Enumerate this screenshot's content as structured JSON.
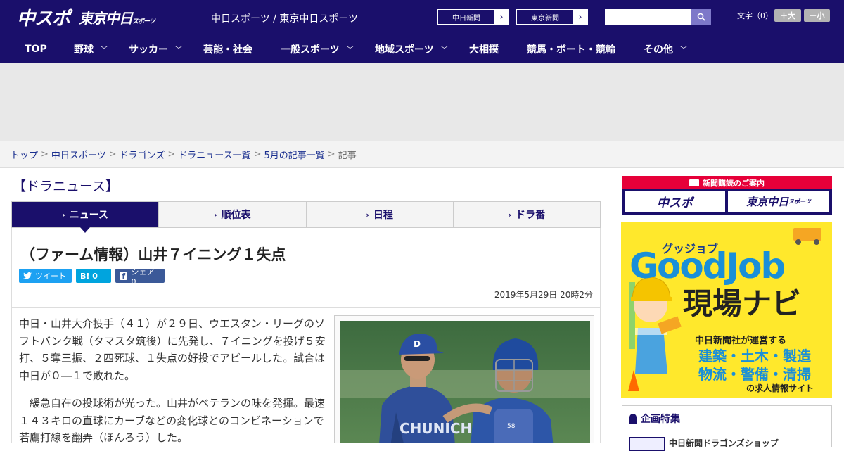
{
  "header": {
    "logo_main": "中スポ",
    "logo_tokyo": "東京中日",
    "logo_tokyo_small": "スポーツ",
    "site_names": "中日スポーツ / 東京中日スポーツ",
    "link_chunichi": "中日新聞",
    "link_tokyo": "東京新聞",
    "font_label": "文字（0）",
    "font_up": "＋大",
    "font_down": "－小"
  },
  "nav": {
    "items": [
      {
        "label": "TOP",
        "has_menu": false
      },
      {
        "label": "野球",
        "has_menu": true
      },
      {
        "label": "サッカー",
        "has_menu": true
      },
      {
        "label": "芸能・社会",
        "has_menu": false
      },
      {
        "label": "一般スポーツ",
        "has_menu": true
      },
      {
        "label": "地域スポーツ",
        "has_menu": true
      },
      {
        "label": "大相撲",
        "has_menu": false
      },
      {
        "label": "競馬・ボート・競輪",
        "has_menu": false
      },
      {
        "label": "その他",
        "has_menu": true
      }
    ]
  },
  "breadcrumb": {
    "items": [
      "トップ",
      "中日スポーツ",
      "ドラゴンズ",
      "ドラニュース一覧",
      "5月の記事一覧"
    ],
    "current": "記事"
  },
  "section": {
    "title": "【ドラニュース】"
  },
  "tabs": [
    {
      "label": "ニュース",
      "active": true
    },
    {
      "label": "順位表",
      "active": false
    },
    {
      "label": "日程",
      "active": false
    },
    {
      "label": "ドラ番",
      "active": false
    }
  ],
  "article": {
    "title": "（ファーム情報）山井７イニング１失点",
    "share_tweet": "ツイート",
    "share_hatena": "B!  0",
    "share_facebook": "シェア 0",
    "date": "2019年5月29日 20時2分",
    "paragraphs": [
      "中日・山井大介投手（４１）が２９日、ウエスタン・リーグのソフトバンク戦（タマスタ筑後）に先発し、７イニングを投げ５安打、５奪三振、２四死球、１失点の好投でアピールした。試合は中日が０―１で敗れた。",
      "　緩急自在の投球術が光った。山井がベテランの味を発揮。最速１４３キロの直球にカーブなどの変化球とのコンビネーションで若鷹打線を翻弄（ほんろう）した。"
    ]
  },
  "sidebar": {
    "subscribe_head": "新聞購読のご案内",
    "subscribe_chuspo": "中スポ",
    "subscribe_tokyo": "東京中日",
    "subscribe_tokyo_small": "スポーツ",
    "job_ad": {
      "kana": "グッジョブ",
      "logo": "GoodJob",
      "headline": "現場ナビ",
      "line1": "中日新聞社が運営する",
      "line2": "建築・土木・製造",
      "line3": "物流・警備・清掃",
      "line4": "の求人情報サイト"
    },
    "feature_head": "企画特集",
    "feature_item": "中日新聞ドラゴンズショップ"
  },
  "colors": {
    "brand_navy": "#1a0f6b",
    "subscribe_red": "#e60039",
    "job_yellow": "#ffe82c",
    "job_blue": "#1a8fd8"
  }
}
